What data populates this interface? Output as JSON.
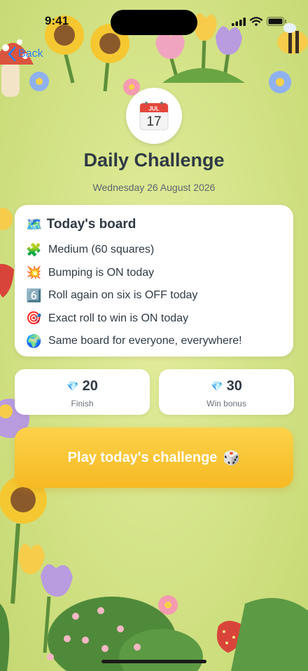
{
  "status_bar": {
    "time": "9:41"
  },
  "nav": {
    "back_label": "Back"
  },
  "header": {
    "calendar_month": "JUL",
    "calendar_day": "17",
    "title": "Daily Challenge",
    "date": "Wednesday 26 August 2026"
  },
  "board": {
    "header_emoji": "🗺️",
    "title": "Today's board",
    "rules": [
      {
        "emoji": "🧩",
        "text": "Medium (60 squares)"
      },
      {
        "emoji": "💥",
        "text": "Bumping is ON today"
      },
      {
        "emoji": "6️⃣",
        "text": "Roll again on six is OFF today"
      },
      {
        "emoji": "🎯",
        "text": "Exact roll to win is ON today"
      },
      {
        "emoji": "🌍",
        "text": "Same board for everyone, everywhere!"
      }
    ]
  },
  "rewards": {
    "finish": {
      "icon": "💎",
      "value": "20",
      "label": "Finish"
    },
    "win": {
      "icon": "💎",
      "value": "30",
      "label": "Win bonus"
    }
  },
  "play": {
    "label": "Play today's challenge",
    "emoji": "🎲"
  },
  "colors": {
    "accent": "#f6b922",
    "link": "#2f7ff5",
    "card": "#ffffff",
    "text": "#2f3a45"
  }
}
